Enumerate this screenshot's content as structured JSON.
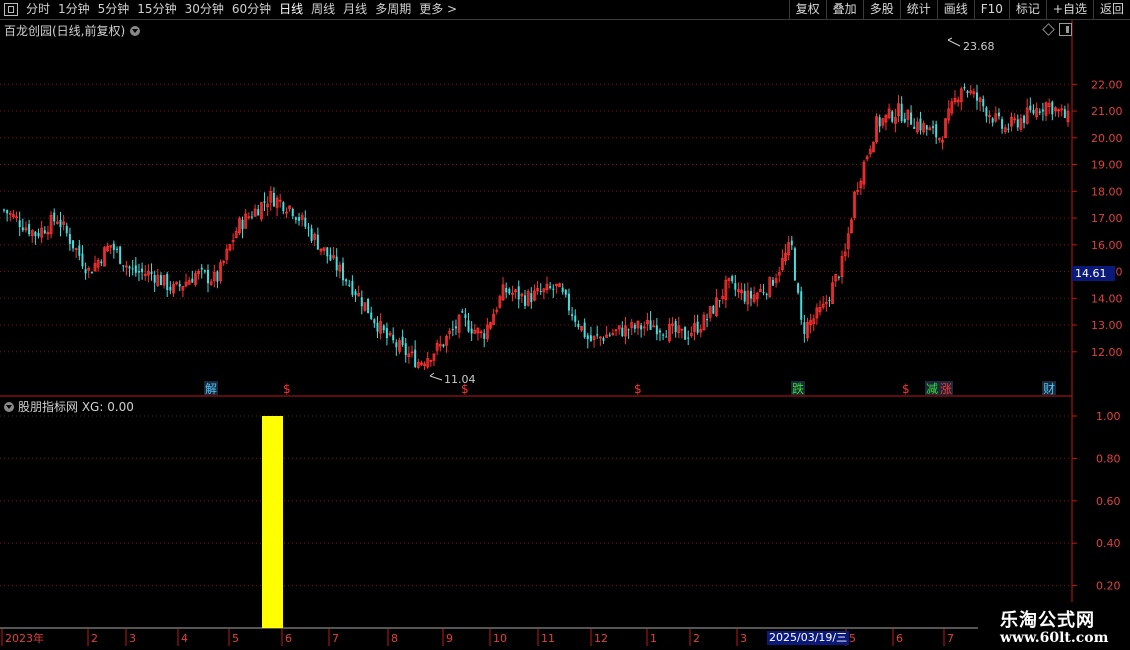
{
  "toolbar": {
    "tabs": [
      "分时",
      "1分钟",
      "5分钟",
      "15分钟",
      "30分钟",
      "60分钟",
      "日线",
      "周线",
      "月线",
      "多周期",
      "更多 >"
    ],
    "active_tab": "日线",
    "buttons": [
      "复权",
      "叠加",
      "多股",
      "统计",
      "画线",
      "F10",
      "标记",
      "+自选",
      "返回"
    ]
  },
  "main_chart": {
    "title": "百龙创园(日线,前复权)",
    "current_price": "14.61",
    "high_label": "23.68",
    "low_label": "11.04",
    "event_markers": [
      {
        "text": "解",
        "color": "#4fc3f7"
      },
      {
        "text": "$",
        "color": "#ff3030"
      },
      {
        "text": "$",
        "color": "#ff3030"
      },
      {
        "text": "$",
        "color": "#ff3030"
      },
      {
        "text": "跌",
        "color": "#33dd33"
      },
      {
        "text": "$",
        "color": "#ff3030"
      },
      {
        "text": "减",
        "color": "#33dd33"
      },
      {
        "text": "涨",
        "color": "#ff3030"
      },
      {
        "text": "财",
        "color": "#4fc3f7"
      }
    ]
  },
  "sub_chart": {
    "title": "股朋指标网 XG: 0.00"
  },
  "x_axis": {
    "labels": [
      "2023年",
      "2",
      "3",
      "4",
      "5",
      "6",
      "7",
      "8",
      "9",
      "10",
      "11",
      "12",
      "1",
      "2",
      "3",
      "2025/03/19/三",
      "5",
      "6",
      "7"
    ]
  },
  "watermark": {
    "line1": "乐淘公式网",
    "line2": "www.60lt.com"
  },
  "colors": {
    "up": "#ff3030",
    "down": "#40e0e0",
    "signal": "#ffff00",
    "grid": "#7a1010",
    "axis": "#c01818"
  },
  "chart_data": [
    {
      "type": "candlestick",
      "title": "百龙创园(日线,前复权)",
      "ylim": [
        11.04,
        23.68
      ],
      "y_ticks": [
        12.0,
        13.0,
        14.0,
        15.0,
        16.0,
        17.0,
        18.0,
        19.0,
        20.0,
        21.0,
        22.0
      ],
      "high": 23.68,
      "low": 11.04,
      "last": 14.61,
      "close_path": [
        {
          "x": 0,
          "close": 17.3
        },
        {
          "x": 0.03,
          "close": 16.4
        },
        {
          "x": 0.05,
          "close": 17.0
        },
        {
          "x": 0.08,
          "close": 15.0
        },
        {
          "x": 0.1,
          "close": 16.0
        },
        {
          "x": 0.12,
          "close": 15.0
        },
        {
          "x": 0.14,
          "close": 14.9
        },
        {
          "x": 0.16,
          "close": 14.3
        },
        {
          "x": 0.18,
          "close": 14.9
        },
        {
          "x": 0.2,
          "close": 14.7
        },
        {
          "x": 0.22,
          "close": 16.7
        },
        {
          "x": 0.25,
          "close": 17.8
        },
        {
          "x": 0.27,
          "close": 17.4
        },
        {
          "x": 0.3,
          "close": 15.8
        },
        {
          "x": 0.33,
          "close": 14.3
        },
        {
          "x": 0.36,
          "close": 12.5
        },
        {
          "x": 0.39,
          "close": 11.6
        },
        {
          "x": 0.41,
          "close": 12.2
        },
        {
          "x": 0.43,
          "close": 13.2
        },
        {
          "x": 0.45,
          "close": 12.6
        },
        {
          "x": 0.47,
          "close": 14.3
        },
        {
          "x": 0.49,
          "close": 14.0
        },
        {
          "x": 0.52,
          "close": 14.4
        },
        {
          "x": 0.55,
          "close": 12.4
        },
        {
          "x": 0.58,
          "close": 12.8
        },
        {
          "x": 0.61,
          "close": 13.0
        },
        {
          "x": 0.64,
          "close": 12.6
        },
        {
          "x": 0.66,
          "close": 13.2
        },
        {
          "x": 0.68,
          "close": 14.5
        },
        {
          "x": 0.7,
          "close": 14.0
        },
        {
          "x": 0.72,
          "close": 14.5
        },
        {
          "x": 0.74,
          "close": 16.0
        },
        {
          "x": 0.75,
          "close": 12.8
        },
        {
          "x": 0.77,
          "close": 13.6
        },
        {
          "x": 0.79,
          "close": 15.5
        },
        {
          "x": 0.8,
          "close": 18.0
        },
        {
          "x": 0.82,
          "close": 20.5
        },
        {
          "x": 0.84,
          "close": 21.0
        },
        {
          "x": 0.86,
          "close": 20.5
        },
        {
          "x": 0.88,
          "close": 20.0
        },
        {
          "x": 0.9,
          "close": 22.0
        },
        {
          "x": 0.92,
          "close": 21.2
        },
        {
          "x": 0.94,
          "close": 20.3
        },
        {
          "x": 0.96,
          "close": 20.8
        },
        {
          "x": 0.98,
          "close": 21.3
        },
        {
          "x": 1.0,
          "close": 20.7
        }
      ]
    },
    {
      "type": "bar",
      "title": "股朋指标网 XG: 0.00",
      "ylim": [
        0,
        1.0
      ],
      "y_ticks": [
        0.2,
        0.4,
        0.6,
        0.8,
        1.0
      ],
      "series": [
        {
          "name": "XG",
          "signal_value": 1.0,
          "signal_near": "6"
        }
      ]
    }
  ]
}
